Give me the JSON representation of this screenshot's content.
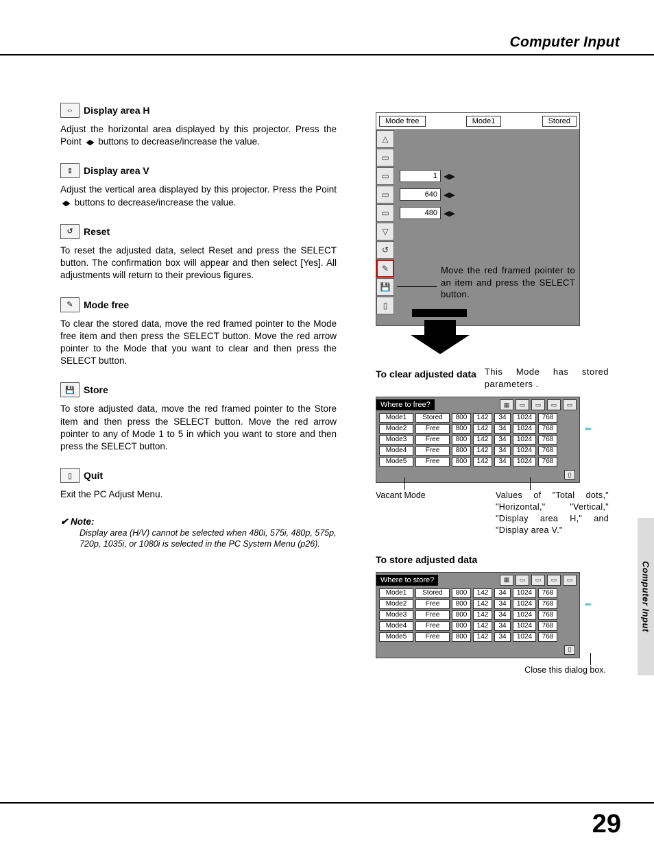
{
  "header": {
    "title": "Computer Input",
    "sidetab": "Computer Input",
    "pagenum": "29"
  },
  "sections": {
    "dh": {
      "title": "Display area H",
      "body_a": "Adjust the horizontal area displayed by this projector.  Press the Point ",
      "body_b": " buttons to decrease/increase the value."
    },
    "dv": {
      "title": "Display area V",
      "body_a": "Adjust the vertical area displayed by this projector.  Press the Point ",
      "body_b": " buttons to decrease/increase the value."
    },
    "reset": {
      "title": "Reset",
      "body": "To reset the adjusted data, select Reset and press the SELECT button.  The confirmation box will appear and then select [Yes].  All adjustments will return to their previous figures."
    },
    "mf": {
      "title": "Mode free",
      "body": "To clear the stored data, move the red framed pointer to the Mode free item and then press the SELECT button.  Move the red arrow pointer to the Mode that you want to clear and then press the SELECT button."
    },
    "store": {
      "title": "Store",
      "body": "To store adjusted data, move the red framed pointer to the Store item and then press the SELECT button.  Move the red arrow pointer to any of Mode 1 to 5 in which you want to store and then press the SELECT button."
    },
    "quit": {
      "title": "Quit",
      "body": "Exit the PC Adjust Menu."
    },
    "note": {
      "head": "✔ Note:",
      "body": "Display area (H/V) cannot be selected when 480i, 575i, 480p, 575p, 720p, 1035i, or 1080i is selected in the PC System Menu (p26)."
    }
  },
  "panel": {
    "tabs": {
      "a": "Mode free",
      "b": "Mode1",
      "c": "Stored"
    },
    "vals": {
      "v1": "1",
      "v2": "640",
      "v3": "480"
    },
    "instr": "Move the red framed pointer to an item and press the SELECT button."
  },
  "clear": {
    "title": "To clear adjusted data",
    "desc": "This Mode has stored parameters ."
  },
  "table_headers": [
    "",
    "",
    "",
    "",
    ""
  ],
  "free_table": {
    "title": "Where to free?",
    "rows": [
      {
        "mode": "Mode1",
        "stat": "Stored",
        "v1": "800",
        "v2": "142",
        "v3": "34",
        "v4": "1024",
        "v5": "768"
      },
      {
        "mode": "Mode2",
        "stat": "Free",
        "v1": "800",
        "v2": "142",
        "v3": "34",
        "v4": "1024",
        "v5": "768"
      },
      {
        "mode": "Mode3",
        "stat": "Free",
        "v1": "800",
        "v2": "142",
        "v3": "34",
        "v4": "1024",
        "v5": "768"
      },
      {
        "mode": "Mode4",
        "stat": "Free",
        "v1": "800",
        "v2": "142",
        "v3": "34",
        "v4": "1024",
        "v5": "768"
      },
      {
        "mode": "Mode5",
        "stat": "Free",
        "v1": "800",
        "v2": "142",
        "v3": "34",
        "v4": "1024",
        "v5": "768"
      }
    ]
  },
  "annots": {
    "vacant": "Vacant Mode",
    "values": "Values of \"Total dots,\" \"Horizontal,\" \"Vertical,\" \"Display area H,\" and \"Display area V.\""
  },
  "store_sec": {
    "title": "To store adjusted data"
  },
  "store_table": {
    "title": "Where to store?",
    "rows": [
      {
        "mode": "Mode1",
        "stat": "Stored",
        "v1": "800",
        "v2": "142",
        "v3": "34",
        "v4": "1024",
        "v5": "768"
      },
      {
        "mode": "Mode2",
        "stat": "Free",
        "v1": "800",
        "v2": "142",
        "v3": "34",
        "v4": "1024",
        "v5": "768"
      },
      {
        "mode": "Mode3",
        "stat": "Free",
        "v1": "800",
        "v2": "142",
        "v3": "34",
        "v4": "1024",
        "v5": "768"
      },
      {
        "mode": "Mode4",
        "stat": "Free",
        "v1": "800",
        "v2": "142",
        "v3": "34",
        "v4": "1024",
        "v5": "768"
      },
      {
        "mode": "Mode5",
        "stat": "Free",
        "v1": "800",
        "v2": "142",
        "v3": "34",
        "v4": "1024",
        "v5": "768"
      }
    ]
  },
  "close_note": "Close this dialog box."
}
